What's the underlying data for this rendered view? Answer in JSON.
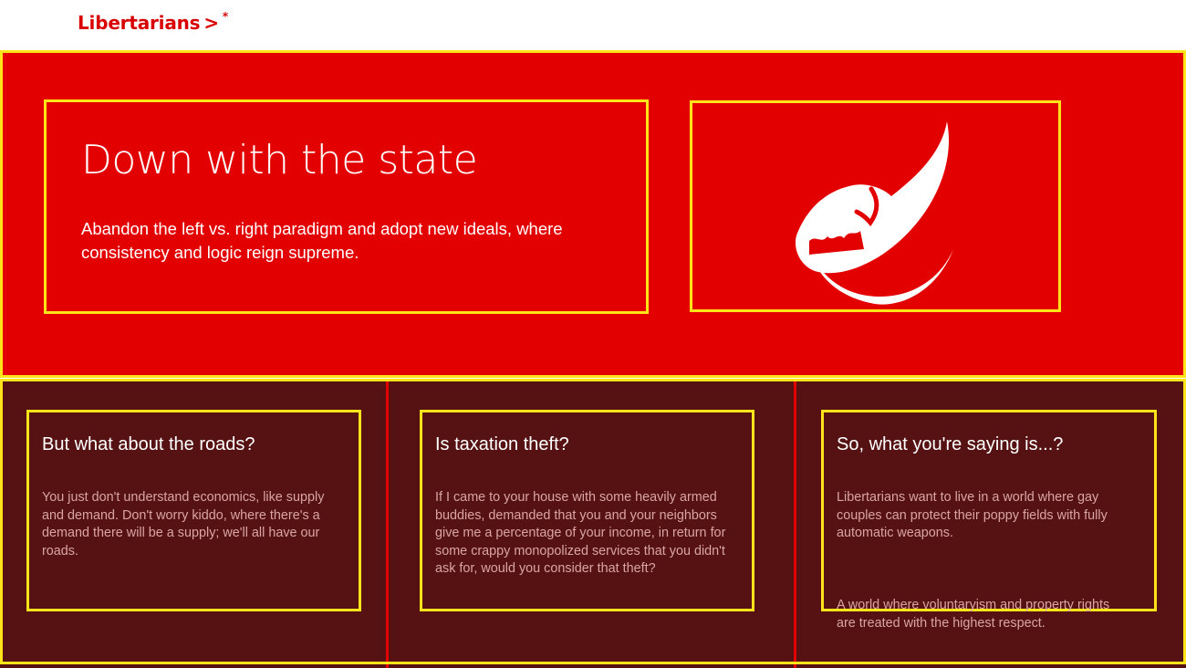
{
  "nav": {
    "brand": "Libertarians",
    "separator": ">",
    "star": "*"
  },
  "hero": {
    "title": "Down with the state",
    "subtitle": "Abandon the left vs. right paradigm and adopt new ideals, where consistency and logic reign supreme.",
    "logo_icon": "eagle-feather-logo-icon"
  },
  "features": [
    {
      "title": "But what about the roads?",
      "body": "You just don't understand economics, like supply and demand. Don't worry kiddo, where there's a demand there will be a supply; we'll all have our roads.",
      "body2": ""
    },
    {
      "title": "Is taxation theft?",
      "body": "If I came to your house with some heavily armed buddies, demanded that you and your neighbors give me a percentage of your income, in return for some crappy monopolized services that you didn't ask for, would you consider that theft?",
      "body2": ""
    },
    {
      "title": "So, what you're saying is...?",
      "body": "Libertarians want to live in a world where gay couples can protect their poppy fields with fully automatic weapons.",
      "body2": "A world where voluntaryism and property rights are treated with the highest respect."
    }
  ],
  "colors": {
    "brand_red": "#e30000",
    "outline_yellow": "#ffe41a",
    "dark_maroon": "#561213",
    "muted_text": "#d9a5a3"
  }
}
